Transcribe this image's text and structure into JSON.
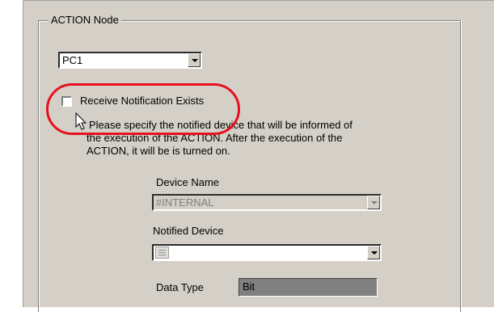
{
  "groupbox": {
    "title": "ACTION Node"
  },
  "node_select": {
    "value": "PC1"
  },
  "receive_notification": {
    "label": "Receive Notification Exists",
    "checked": false,
    "description_lines": [
      "Please specify the notified device that will be informed of",
      "the execution of the ACTION. After the execution of the",
      "ACTION, it will be is turned on."
    ]
  },
  "device_name": {
    "label": "Device Name",
    "value": "#INTERNAL"
  },
  "notified_device": {
    "label": "Notified Device",
    "value": "",
    "icon": "device-address-icon"
  },
  "data_type": {
    "label": "Data Type",
    "value": "Bit"
  },
  "highlight_color": "#e8101c"
}
